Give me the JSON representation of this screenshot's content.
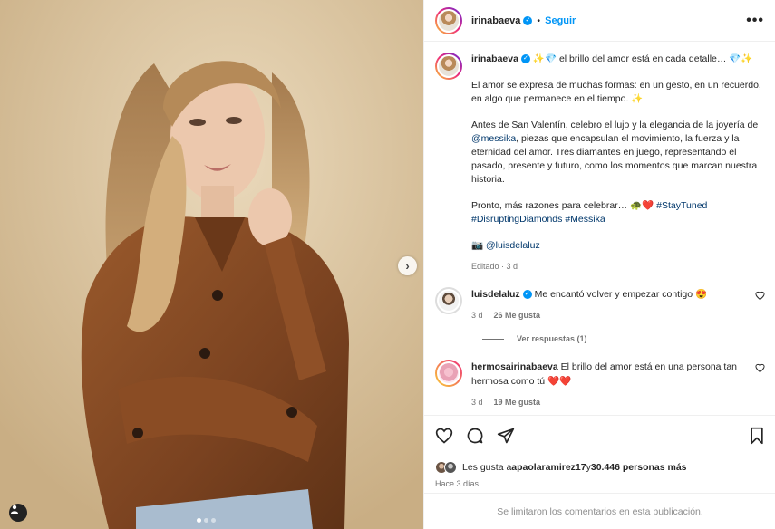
{
  "post": {
    "username": "irinabaeva",
    "follow_label": "Seguir",
    "separator": "•",
    "more_label": "•••"
  },
  "caption": {
    "username": "irinabaeva",
    "first_line": "✨💎 el brillo del amor está en cada detalle… 💎✨",
    "p1": "El amor se expresa de muchas formas: en un gesto, en un recuerdo, en algo que permanece en el tiempo. ✨",
    "p2_before": "Antes de San Valentín, celebro el lujo y la elegancia de la joyería de ",
    "p2_mention": "@messika",
    "p2_after": ", piezas que encapsulan el movimiento, la fuerza y la eternidad del amor. Tres diamantes en juego, representando el pasado, presente y futuro, como los momentos que marcan nuestra historia.",
    "p3_text": "Pronto, más razones para celebrar… 🐢❤️ ",
    "p3_tag1": "#StayTuned",
    "p3_tag2": "#DisruptingDiamonds",
    "p3_tag3": "#Messika",
    "photo_credit_icon": "📷",
    "photo_credit": "@luisdelaluz",
    "edited": "Editado · 3 d"
  },
  "comments": [
    {
      "username": "luisdelaluz",
      "text": "Me encantó volver y empezar contigo 😍",
      "time": "3 d",
      "likes": "26 Me gusta",
      "verified": true
    },
    {
      "username": "hermosairinabaeva",
      "text": "El brillo del amor está en una persona tan hermosa como tú ❤️❤️",
      "time": "3 d",
      "likes": "19 Me gusta",
      "verified": false
    }
  ],
  "replies_label": "Ver respuestas (1)",
  "likes_line": {
    "prefix": "Les gusta a ",
    "user": "apaolaramirez17",
    "middle": " y ",
    "count": "30.446 personas más"
  },
  "posted_ago": "Hace 3 días",
  "footer": "Se limitaron los comentarios en esta publicación.",
  "next_arrow": "›",
  "colors": {
    "accent": "#0095f6",
    "link": "#00376b",
    "muted": "#737373",
    "heart": "#ed4956"
  },
  "icons": [
    "tag-icon",
    "next-arrow-icon",
    "more-options-icon",
    "heart-icon",
    "comment-icon",
    "share-icon",
    "bookmark-icon",
    "verified-badge-icon"
  ],
  "carousel": {
    "count": 3,
    "active_index": 0
  }
}
